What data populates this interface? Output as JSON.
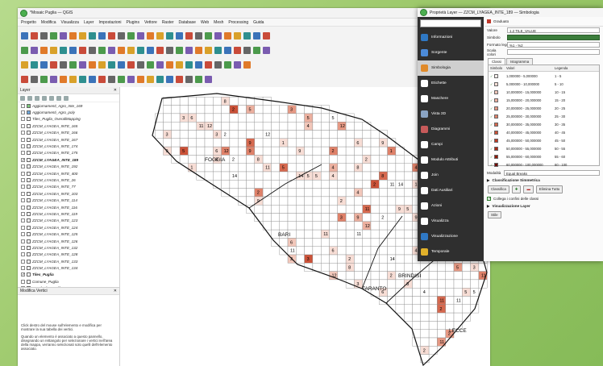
{
  "window": {
    "title": "*Mosaic Puglia — QGIS"
  },
  "menu": [
    "Progetto",
    "Modifica",
    "Visualizza",
    "Layer",
    "Impostazioni",
    "Plugins",
    "Vettore",
    "Raster",
    "Database",
    "Web",
    "Mesh",
    "Processing",
    "Guida"
  ],
  "layers_panel": {
    "title": "Layer",
    "items": [
      {
        "label": "Aggiornamenti_Agro_Inte_169",
        "checked": false,
        "color": "#7dc97d"
      },
      {
        "label": "Aggiornamenti_Agro_poly",
        "checked": false,
        "color": "#6fa8dc"
      },
      {
        "label": "Tiles_Puglia_OverallMapping",
        "checked": false,
        "color": ""
      },
      {
        "label": "ZZCM_LYAGEA_INTE_165",
        "checked": false,
        "color": ""
      },
      {
        "label": "ZZCM_LYAGEA_INTE_166",
        "checked": false,
        "color": ""
      },
      {
        "label": "ZZCM_LYAGEA_INTE_167",
        "checked": false,
        "color": ""
      },
      {
        "label": "ZZCM_LYAGEA_INTE_174",
        "checked": false,
        "color": ""
      },
      {
        "label": "ZZCM_LYAGEA_INTE_175",
        "checked": false,
        "color": ""
      },
      {
        "label": "ZZCM_LYAGEA_INTE_189",
        "checked": true,
        "color": ""
      },
      {
        "label": "ZZCM_LYAGEA_INTE_192",
        "checked": false,
        "color": ""
      },
      {
        "label": "ZZCM_LYAGEA_INTE_400",
        "checked": false,
        "color": ""
      },
      {
        "label": "ZZCM_LYAGEA_INTE_26",
        "checked": false,
        "color": ""
      },
      {
        "label": "ZZCM_LYAGEA_INTE_77",
        "checked": false,
        "color": ""
      },
      {
        "label": "ZZCM_LYAGEA_INTE_103",
        "checked": false,
        "color": ""
      },
      {
        "label": "ZZCM_LYAGEA_INTE_114",
        "checked": false,
        "color": ""
      },
      {
        "label": "ZZCM_LYAGEA_INTE_116",
        "checked": false,
        "color": ""
      },
      {
        "label": "ZZCM_LYAGEA_INTE_119",
        "checked": false,
        "color": ""
      },
      {
        "label": "ZZCM_LYAGEA_INTE_123",
        "checked": false,
        "color": ""
      },
      {
        "label": "ZZCM_LYAGEA_INTE_124",
        "checked": false,
        "color": ""
      },
      {
        "label": "ZZCM_LYAGEA_INTE_125",
        "checked": false,
        "color": ""
      },
      {
        "label": "ZZCM_LYAGEA_INTE_126",
        "checked": false,
        "color": ""
      },
      {
        "label": "ZZCM_LYAGEA_INTE_132",
        "checked": false,
        "color": ""
      },
      {
        "label": "ZZCM_LYAGEA_INTE_128",
        "checked": false,
        "color": ""
      },
      {
        "label": "ZZCM_LYAGEA_INTE_133",
        "checked": false,
        "color": ""
      },
      {
        "label": "ZZCM_LYAGEA_INTE_134",
        "checked": false,
        "color": ""
      },
      {
        "label": "Tiles_Puglia",
        "checked": true,
        "color": ""
      },
      {
        "label": "Comune_Puglia",
        "checked": false,
        "color": ""
      },
      {
        "label": "Provincia_Puglia",
        "checked": true,
        "color": ""
      },
      {
        "label": "Regione_Puglia",
        "checked": false,
        "color": ""
      }
    ]
  },
  "vertex_panel": {
    "title": "Modifica Vertici",
    "text1": "Click destro del mouse sull'elemento e modifica per mostrare la sua tabella dei vertici.",
    "text2": "Quando un elemento è associato a questo pannello, disegnando un rettangolo per selezionare i vertici nell'area della mappa, verranno selezionati solo quelli dell'elemento associato."
  },
  "map": {
    "labels": [
      "FOGGIA",
      "BARI",
      "TARANTO",
      "BRINDISI",
      "LECCE"
    ],
    "counts": [
      "1",
      "2",
      "3",
      "4",
      "5",
      "6",
      "8",
      "9",
      "14",
      "12",
      "11"
    ]
  },
  "dialog": {
    "title": "Proprietà Layer — ZZCM_LYAGEA_INTE_189 — Simbologia",
    "nav": [
      "Informazioni",
      "Sorgente",
      "Simbologia",
      "Etichette",
      "Maschere",
      "Vista 3D",
      "Diagrammi",
      "Campi",
      "Modulo Attributi",
      "Join",
      "Dati Ausiliari",
      "Azioni",
      "Visualizza",
      "Visualizzazione",
      "Temporale",
      "Variabili"
    ],
    "renderer": "Graduato",
    "value_label": "Valore",
    "value": "1.2 TILE_VALUE",
    "symbol_label": "Simbolo",
    "format_label": "Formato legenda",
    "format_value": "%1 - %2",
    "ramp_label": "Scala colori",
    "tabs": [
      "Classi",
      "Istogramma"
    ],
    "columns": [
      "Simbolo",
      "Valori",
      "Legenda"
    ],
    "classes": [
      {
        "values": "1,000000 - 5,000000",
        "legend": "1 - 5",
        "color": "#fbf1ee"
      },
      {
        "values": "5,000000 - 10,000000",
        "legend": "5 - 10",
        "color": "#f7ddd5"
      },
      {
        "values": "10,000000 - 15,000000",
        "legend": "10 - 15",
        "color": "#f2c7ba"
      },
      {
        "values": "15,000000 - 20,000000",
        "legend": "15 - 20",
        "color": "#ecb09f"
      },
      {
        "values": "20,000000 - 25,000000",
        "legend": "20 - 25",
        "color": "#e69984"
      },
      {
        "values": "25,000000 - 30,000000",
        "legend": "25 - 30",
        "color": "#df8169"
      },
      {
        "values": "30,000000 - 35,000000",
        "legend": "30 - 35",
        "color": "#d6694f"
      },
      {
        "values": "40,000000 - 45,000000",
        "legend": "40 - 45",
        "color": "#cb5238"
      },
      {
        "values": "45,000000 - 50,000000",
        "legend": "45 - 50",
        "color": "#bd3c25"
      },
      {
        "values": "50,000000 - 55,000000",
        "legend": "50 - 55",
        "color": "#a92914"
      },
      {
        "values": "55,000000 - 60,000000",
        "legend": "55 - 60",
        "color": "#901a08"
      },
      {
        "values": "60,000000 - 100,000000",
        "legend": "60 - 100",
        "color": "#6e0d02"
      }
    ],
    "mode_label": "Modalità",
    "mode_value": "Equal Breaks",
    "classify_section": "Classificazione Simmetrica",
    "classify_btn": "Classifica",
    "delete_all_btn": "Elimina Tutto",
    "link_label": "Collega i confini delle classi",
    "render_section": "Visualizzazione Layer",
    "style_btn": "Stile"
  }
}
